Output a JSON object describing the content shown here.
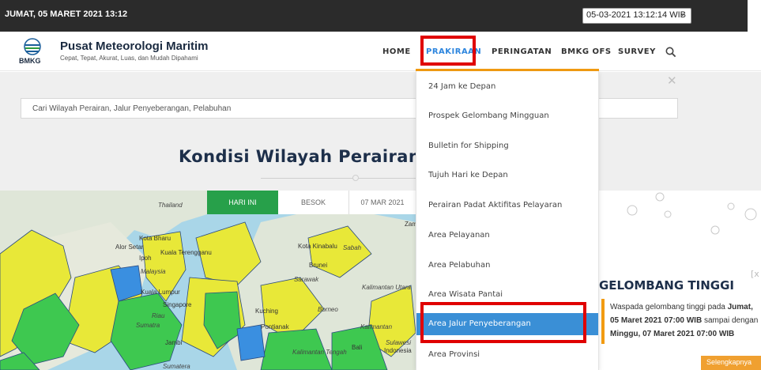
{
  "topbar": {
    "date_text": "JUMAT, 05 MARET 2021 13:12",
    "timezone_value": "05-03-2021 13:12:14 WIB"
  },
  "brand": {
    "logo_text": "BMKG",
    "title": "Pusat Meteorologi Maritim",
    "subtitle": "Cepat, Tepat, Akurat, Luas, dan Mudah Dipahami"
  },
  "nav": {
    "items": [
      {
        "label": "HOME"
      },
      {
        "label": "PRAKIRAAN",
        "active": true
      },
      {
        "label": "PERINGATAN"
      },
      {
        "label": "BMKG OFS"
      },
      {
        "label": "SURVEY"
      }
    ]
  },
  "hero": {
    "search_placeholder": "Cari Wilayah Perairan, Jalur Penyeberangan, Pelabuhan",
    "title": "Kondisi Wilayah Perairan"
  },
  "map": {
    "tabs": [
      {
        "label": "HARI INI",
        "active": true
      },
      {
        "label": "BESOK"
      },
      {
        "label": "07 MAR 2021"
      }
    ],
    "labels": [
      "Kota Bharu",
      "Alor Setar",
      "Kuala Terengganu",
      "Ipoh",
      "Malaysia",
      "Kuala Lumpur",
      "Singapore",
      "Riau",
      "Sumatra",
      "Jambi",
      "Sumatera",
      "Kota Kinabalu",
      "Sabah",
      "Brunei",
      "Sarawak",
      "Kalimantan Utara",
      "Kuching",
      "Borneo",
      "Pontianak",
      "Kalimantan",
      "Kalimantan Tengah",
      "Bali",
      "Sulawesi",
      "Indonesia",
      "Thailand",
      "Zam"
    ]
  },
  "dropdown": {
    "items": [
      {
        "label": "24 Jam ke Depan"
      },
      {
        "label": "Prospek Gelombang Mingguan"
      },
      {
        "label": "Bulletin for Shipping"
      },
      {
        "label": "Tujuh Hari ke Depan"
      },
      {
        "label": "Perairan Padat Aktifitas Pelayaran"
      },
      {
        "label": "Area Pelayanan"
      },
      {
        "label": "Area Pelabuhan"
      },
      {
        "label": "Area Wisata Pantai"
      },
      {
        "label": "Area Jalur Penyeberangan",
        "active": true
      },
      {
        "label": "Area Provinsi"
      }
    ]
  },
  "warning": {
    "title": "GELOMBANG TINGGI",
    "text_prefix": "Waspada gelombang tinggi pada ",
    "start": "Jumat, 05 Maret 2021 07:00 WIB",
    "text_middle": " sampai dengan ",
    "end": "Minggu, 07 Maret 2021 07:00 WIB",
    "more_label": "Selengkapnya"
  },
  "colors": {
    "topbar": "#2b2b2b",
    "accent_blue": "#2e86de",
    "accent_orange": "#f39c12",
    "highlight_red": "#e00000",
    "active_green": "#27a04a",
    "dropdown_active": "#3a8fd6"
  }
}
